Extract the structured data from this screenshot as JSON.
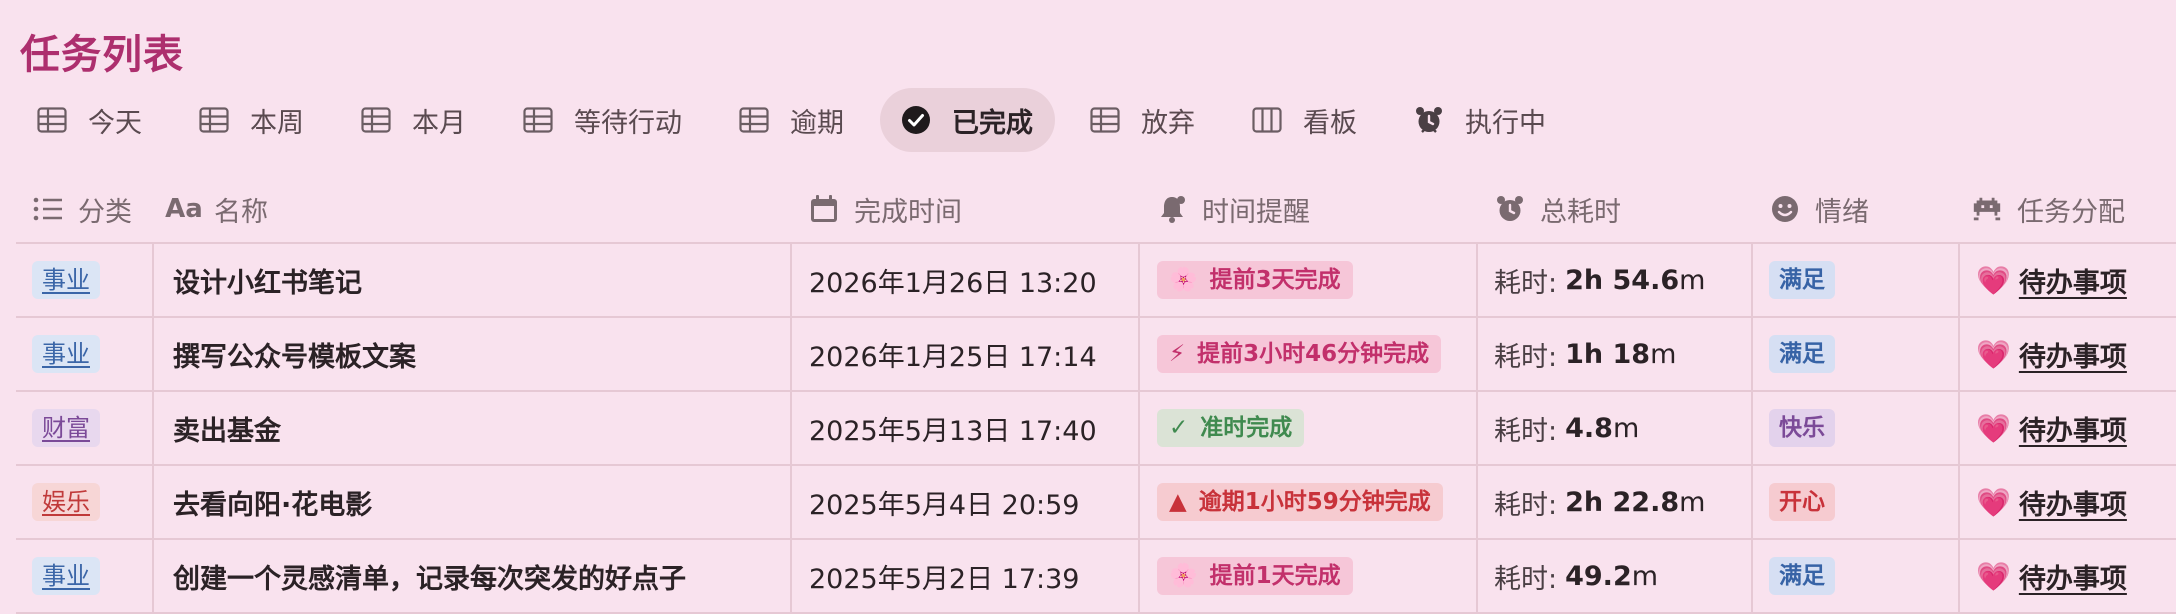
{
  "page": {
    "title": "任务列表"
  },
  "tabs": [
    {
      "label": "今天",
      "icon": "table-icon",
      "active": false
    },
    {
      "label": "本周",
      "icon": "table-icon",
      "active": false
    },
    {
      "label": "本月",
      "icon": "table-icon",
      "active": false
    },
    {
      "label": "等待行动",
      "icon": "table-icon",
      "active": false
    },
    {
      "label": "逾期",
      "icon": "table-icon",
      "active": false
    },
    {
      "label": "已完成",
      "icon": "check-circle-icon",
      "active": true
    },
    {
      "label": "放弃",
      "icon": "table-icon",
      "active": false
    },
    {
      "label": "看板",
      "icon": "board-icon",
      "active": false
    },
    {
      "label": "执行中",
      "icon": "alarm-clock-icon",
      "active": false
    }
  ],
  "columns": {
    "category": {
      "label": "分类",
      "icon": "list-icon"
    },
    "name": {
      "label": "名称",
      "icon": "text-aa-icon",
      "icon_text": "Aa"
    },
    "completed_at": {
      "label": "完成时间",
      "icon": "calendar-icon"
    },
    "reminder": {
      "label": "时间提醒",
      "icon": "bell-icon"
    },
    "duration": {
      "label": "总耗时",
      "icon": "alarm-clock-icon"
    },
    "mood": {
      "label": "情绪",
      "icon": "smile-icon"
    },
    "assignment": {
      "label": "任务分配",
      "icon": "invader-icon"
    }
  },
  "rows": [
    {
      "category": "事业",
      "category_color": "blue",
      "name": "设计小红书笔记",
      "completed_at": "2026年1月26日 13:20",
      "reminder": {
        "emoji": "🌸",
        "text": "提前3天完成",
        "color": "pink"
      },
      "duration": {
        "prefix": "耗时:",
        "value": "2h 54.6",
        "unit": "m"
      },
      "mood": {
        "text": "满足",
        "color": "blue"
      },
      "assignment": {
        "emoji": "💗",
        "text": "待办事项"
      }
    },
    {
      "category": "事业",
      "category_color": "blue",
      "name": "撰写公众号模板文案",
      "completed_at": "2026年1月25日 17:14",
      "reminder": {
        "emoji": "⚡",
        "text": "提前3小时46分钟完成",
        "color": "pink"
      },
      "duration": {
        "prefix": "耗时:",
        "value": "1h 18",
        "unit": "m"
      },
      "mood": {
        "text": "满足",
        "color": "blue"
      },
      "assignment": {
        "emoji": "💗",
        "text": "待办事项"
      }
    },
    {
      "category": "财富",
      "category_color": "purple",
      "name": "卖出基金",
      "completed_at": "2025年5月13日 17:40",
      "reminder": {
        "emoji": "✓",
        "text": "准时完成",
        "color": "green"
      },
      "duration": {
        "prefix": "耗时:",
        "value": "4.8",
        "unit": "m"
      },
      "mood": {
        "text": "快乐",
        "color": "purple"
      },
      "assignment": {
        "emoji": "💗",
        "text": "待办事项"
      }
    },
    {
      "category": "娱乐",
      "category_color": "red",
      "name": "去看向阳·花电影",
      "completed_at": "2025年5月4日 20:59",
      "reminder": {
        "emoji": "▲",
        "text": "逾期1小时59分钟完成",
        "color": "red"
      },
      "duration": {
        "prefix": "耗时:",
        "value": "2h 22.8",
        "unit": "m"
      },
      "mood": {
        "text": "开心",
        "color": "red"
      },
      "assignment": {
        "emoji": "💗",
        "text": "待办事项"
      }
    },
    {
      "category": "事业",
      "category_color": "blue",
      "name": "创建一个灵感清单，记录每次突发的好点子",
      "completed_at": "2025年5月2日 17:39",
      "reminder": {
        "emoji": "🌸",
        "text": "提前1天完成",
        "color": "pink"
      },
      "duration": {
        "prefix": "耗时:",
        "value": "49.2",
        "unit": "m"
      },
      "mood": {
        "text": "满足",
        "color": "blue"
      },
      "assignment": {
        "emoji": "💗",
        "text": "待办事项"
      }
    }
  ]
}
